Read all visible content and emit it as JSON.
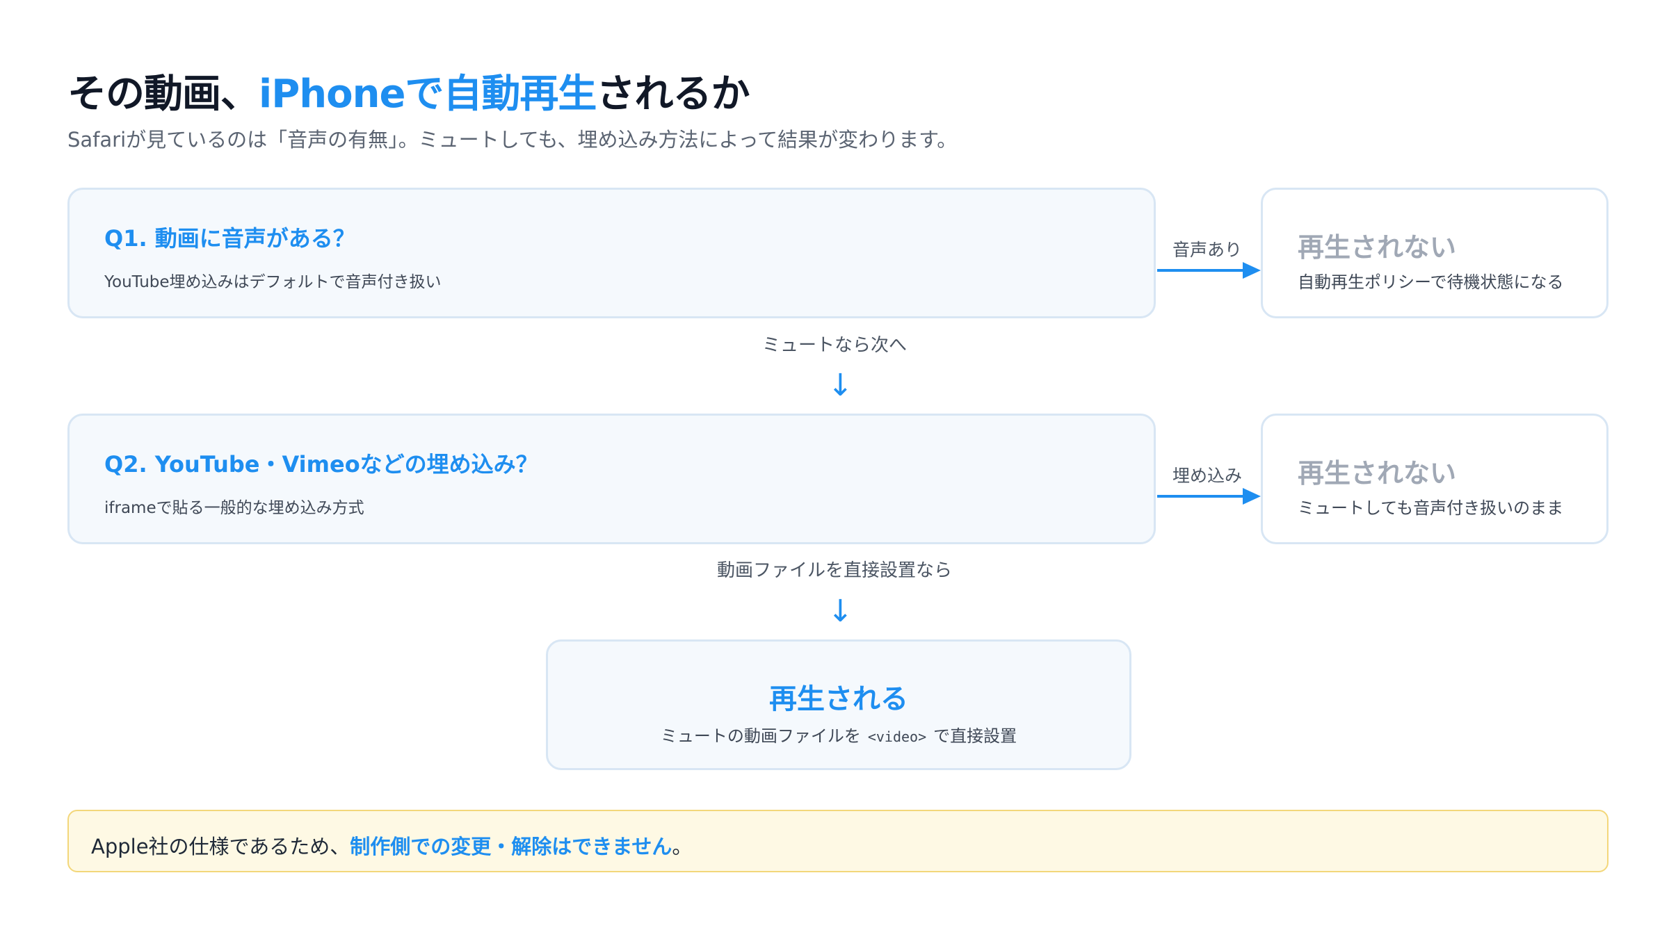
{
  "header": {
    "title_pre": "その動画、",
    "title_accent": "iPhoneで自動再生",
    "title_post": "されるか",
    "subtitle": "Safariが見ているのは「音声の有無」。ミュートしても、埋め込み方法によって結果が変わります。"
  },
  "q1": {
    "title": "Q1. 動画に音声がある？",
    "desc": "YouTube埋め込みはデフォルトで音声付き扱い",
    "edge_label": "音声あり",
    "result_title": "再生されない",
    "result_desc": "自動再生ポリシーで待機状態になる",
    "down_label": "ミュートなら次へ"
  },
  "q2": {
    "title": "Q2. YouTube・Vimeoなどの埋め込み？",
    "desc": "iframeで貼る一般的な埋め込み方式",
    "edge_label": "埋め込み",
    "result_title": "再生されない",
    "result_desc": "ミュートしても音声付き扱いのまま",
    "down_label": "動画ファイルを直接設置なら"
  },
  "final": {
    "title": "再生される",
    "desc_pre": "ミュートの動画ファイルを",
    "desc_code": "<video>",
    "desc_post": "で直接設置"
  },
  "note": {
    "pre": "Apple社の仕様であるため、",
    "highlight": "制作側での変更・解除はできません",
    "post": "。"
  },
  "colors": {
    "accent": "#1e8ef0",
    "muted_result": "#a0a8b5",
    "note_bg": "#fef9e4"
  }
}
